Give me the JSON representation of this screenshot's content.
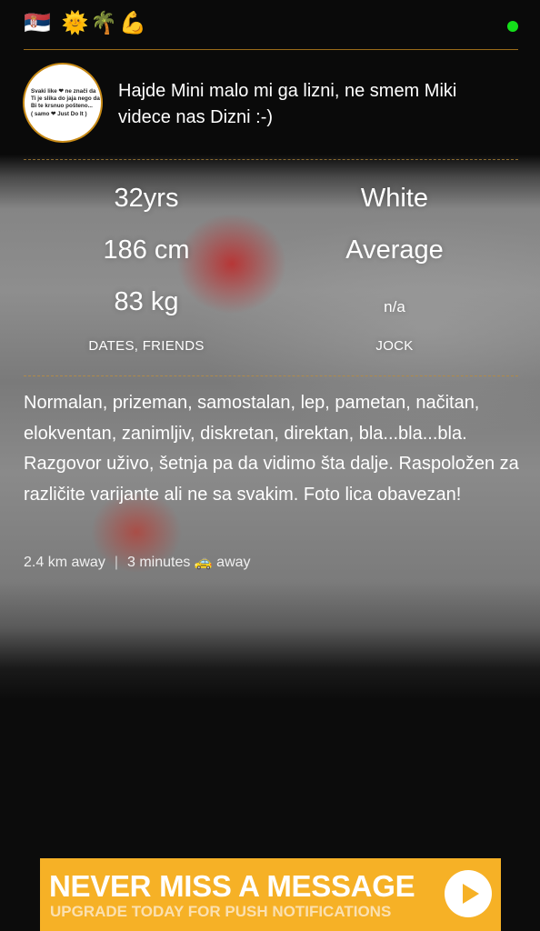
{
  "header": {
    "emojis": "🇷🇸 🌞🌴💪",
    "online_color": "#14e01a"
  },
  "profile": {
    "avatar_text": "Svaki like ❤ ne znači da\nTi je slika do jaja nego da\nBi te krsnuo pošteno...\n( samo ❤ Just Do It )",
    "headline": "Hajde Mini malo mi ga lizni, ne smem Miki videce nas Dizni :-)"
  },
  "stats": {
    "age": "32yrs",
    "height": "186 cm",
    "weight": "83 kg",
    "looking_for": "DATES, FRIENDS",
    "ethnicity": "White",
    "body_type": "Average",
    "position": "n/a",
    "tribe": "JOCK"
  },
  "bio": "Normalan, prizeman, samostalan, lep, pametan, načitan, elokventan, zanimljiv, diskretan, direktan, bla...bla...bla. Razgovor uživo, šetnja pa da vidimo šta dalje. Raspoložen za različite varijante ali ne sa svakim. Foto lica obavezan!",
  "distance": {
    "km": "2.4 km away",
    "separator": "|",
    "time": "3 minutes",
    "car_icon": "🚕",
    "suffix": "away"
  },
  "ad": {
    "title": "NEVER MISS A MESSAGE",
    "subtitle": "UPGRADE TODAY FOR PUSH NOTIFICATIONS",
    "accent": "#f6b126",
    "icon": "play-icon"
  }
}
